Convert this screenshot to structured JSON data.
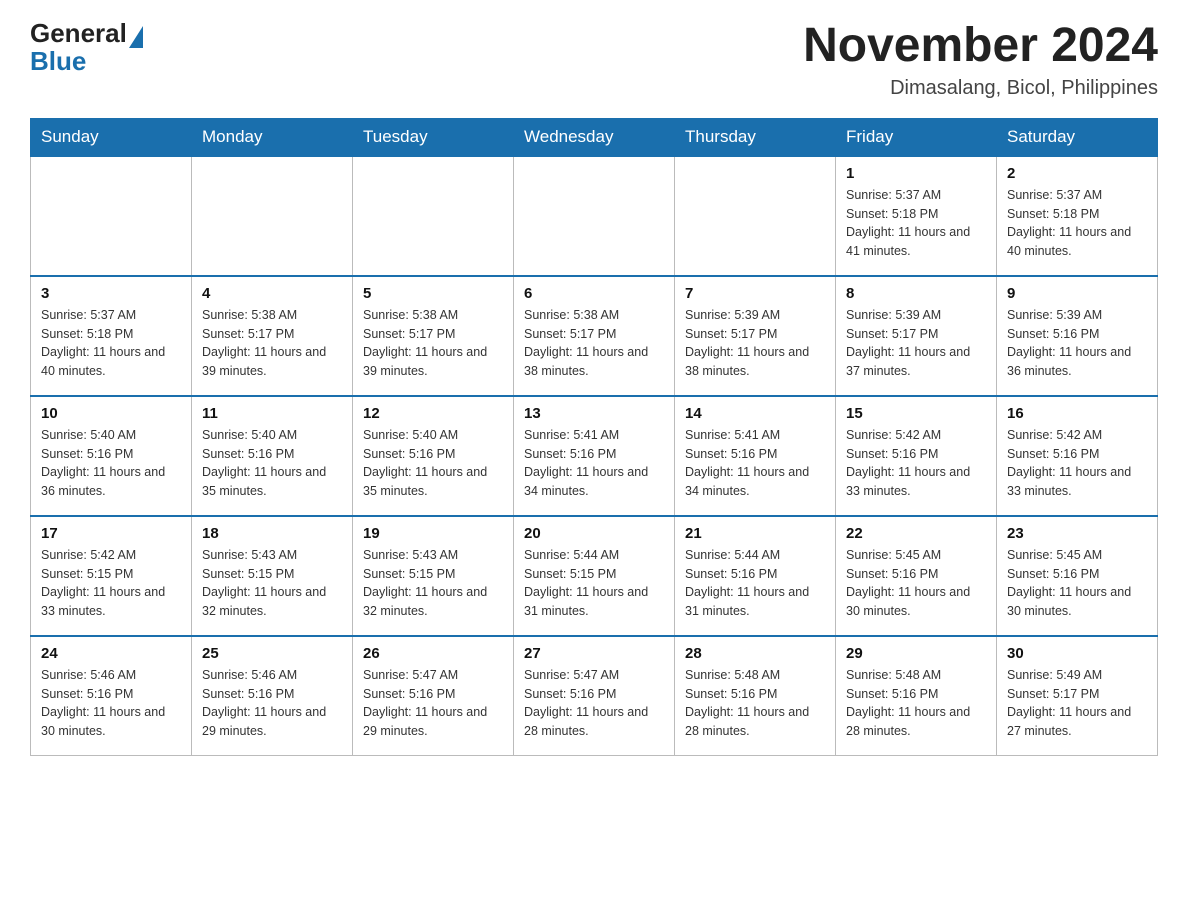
{
  "header": {
    "logo_general": "General",
    "logo_blue": "Blue",
    "title": "November 2024",
    "subtitle": "Dimasalang, Bicol, Philippines"
  },
  "calendar": {
    "weekdays": [
      "Sunday",
      "Monday",
      "Tuesday",
      "Wednesday",
      "Thursday",
      "Friday",
      "Saturday"
    ],
    "weeks": [
      [
        {
          "day": "",
          "info": "",
          "empty": true
        },
        {
          "day": "",
          "info": "",
          "empty": true
        },
        {
          "day": "",
          "info": "",
          "empty": true
        },
        {
          "day": "",
          "info": "",
          "empty": true
        },
        {
          "day": "",
          "info": "",
          "empty": true
        },
        {
          "day": "1",
          "info": "Sunrise: 5:37 AM\nSunset: 5:18 PM\nDaylight: 11 hours and 41 minutes."
        },
        {
          "day": "2",
          "info": "Sunrise: 5:37 AM\nSunset: 5:18 PM\nDaylight: 11 hours and 40 minutes."
        }
      ],
      [
        {
          "day": "3",
          "info": "Sunrise: 5:37 AM\nSunset: 5:18 PM\nDaylight: 11 hours and 40 minutes."
        },
        {
          "day": "4",
          "info": "Sunrise: 5:38 AM\nSunset: 5:17 PM\nDaylight: 11 hours and 39 minutes."
        },
        {
          "day": "5",
          "info": "Sunrise: 5:38 AM\nSunset: 5:17 PM\nDaylight: 11 hours and 39 minutes."
        },
        {
          "day": "6",
          "info": "Sunrise: 5:38 AM\nSunset: 5:17 PM\nDaylight: 11 hours and 38 minutes."
        },
        {
          "day": "7",
          "info": "Sunrise: 5:39 AM\nSunset: 5:17 PM\nDaylight: 11 hours and 38 minutes."
        },
        {
          "day": "8",
          "info": "Sunrise: 5:39 AM\nSunset: 5:17 PM\nDaylight: 11 hours and 37 minutes."
        },
        {
          "day": "9",
          "info": "Sunrise: 5:39 AM\nSunset: 5:16 PM\nDaylight: 11 hours and 36 minutes."
        }
      ],
      [
        {
          "day": "10",
          "info": "Sunrise: 5:40 AM\nSunset: 5:16 PM\nDaylight: 11 hours and 36 minutes."
        },
        {
          "day": "11",
          "info": "Sunrise: 5:40 AM\nSunset: 5:16 PM\nDaylight: 11 hours and 35 minutes."
        },
        {
          "day": "12",
          "info": "Sunrise: 5:40 AM\nSunset: 5:16 PM\nDaylight: 11 hours and 35 minutes."
        },
        {
          "day": "13",
          "info": "Sunrise: 5:41 AM\nSunset: 5:16 PM\nDaylight: 11 hours and 34 minutes."
        },
        {
          "day": "14",
          "info": "Sunrise: 5:41 AM\nSunset: 5:16 PM\nDaylight: 11 hours and 34 minutes."
        },
        {
          "day": "15",
          "info": "Sunrise: 5:42 AM\nSunset: 5:16 PM\nDaylight: 11 hours and 33 minutes."
        },
        {
          "day": "16",
          "info": "Sunrise: 5:42 AM\nSunset: 5:16 PM\nDaylight: 11 hours and 33 minutes."
        }
      ],
      [
        {
          "day": "17",
          "info": "Sunrise: 5:42 AM\nSunset: 5:15 PM\nDaylight: 11 hours and 33 minutes."
        },
        {
          "day": "18",
          "info": "Sunrise: 5:43 AM\nSunset: 5:15 PM\nDaylight: 11 hours and 32 minutes."
        },
        {
          "day": "19",
          "info": "Sunrise: 5:43 AM\nSunset: 5:15 PM\nDaylight: 11 hours and 32 minutes."
        },
        {
          "day": "20",
          "info": "Sunrise: 5:44 AM\nSunset: 5:15 PM\nDaylight: 11 hours and 31 minutes."
        },
        {
          "day": "21",
          "info": "Sunrise: 5:44 AM\nSunset: 5:16 PM\nDaylight: 11 hours and 31 minutes."
        },
        {
          "day": "22",
          "info": "Sunrise: 5:45 AM\nSunset: 5:16 PM\nDaylight: 11 hours and 30 minutes."
        },
        {
          "day": "23",
          "info": "Sunrise: 5:45 AM\nSunset: 5:16 PM\nDaylight: 11 hours and 30 minutes."
        }
      ],
      [
        {
          "day": "24",
          "info": "Sunrise: 5:46 AM\nSunset: 5:16 PM\nDaylight: 11 hours and 30 minutes."
        },
        {
          "day": "25",
          "info": "Sunrise: 5:46 AM\nSunset: 5:16 PM\nDaylight: 11 hours and 29 minutes."
        },
        {
          "day": "26",
          "info": "Sunrise: 5:47 AM\nSunset: 5:16 PM\nDaylight: 11 hours and 29 minutes."
        },
        {
          "day": "27",
          "info": "Sunrise: 5:47 AM\nSunset: 5:16 PM\nDaylight: 11 hours and 28 minutes."
        },
        {
          "day": "28",
          "info": "Sunrise: 5:48 AM\nSunset: 5:16 PM\nDaylight: 11 hours and 28 minutes."
        },
        {
          "day": "29",
          "info": "Sunrise: 5:48 AM\nSunset: 5:16 PM\nDaylight: 11 hours and 28 minutes."
        },
        {
          "day": "30",
          "info": "Sunrise: 5:49 AM\nSunset: 5:17 PM\nDaylight: 11 hours and 27 minutes."
        }
      ]
    ]
  }
}
